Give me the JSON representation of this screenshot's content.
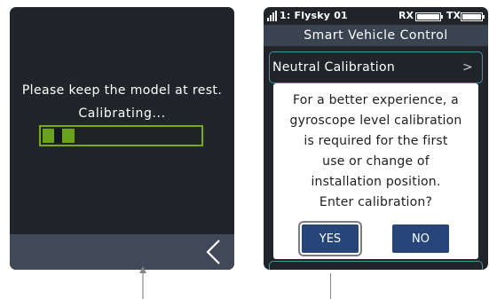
{
  "left_screen": {
    "message": "Please keep the model at rest.",
    "status": "Calibrating...",
    "progress": 0.22,
    "back_icon": "chevron-left-icon"
  },
  "right_screen": {
    "status_bar": {
      "model": "1: Flysky 01",
      "rx_label": "RX",
      "tx_label": "TX"
    },
    "title": "Smart Vehicle Control",
    "list_item": "Neutral Calibration",
    "list_arrow": ">",
    "dialog": {
      "lines": [
        "For a better experience, a",
        "gyroscope level calibration",
        "is required for the first",
        "use or change of",
        "installation position.",
        "Enter calibration?"
      ],
      "yes_label": "YES",
      "no_label": "NO"
    }
  },
  "colors": {
    "screen_bg": "#212429",
    "progress_green": "#6aa21d",
    "accent_teal": "#3a97a8",
    "button_blue": "#26467a"
  }
}
